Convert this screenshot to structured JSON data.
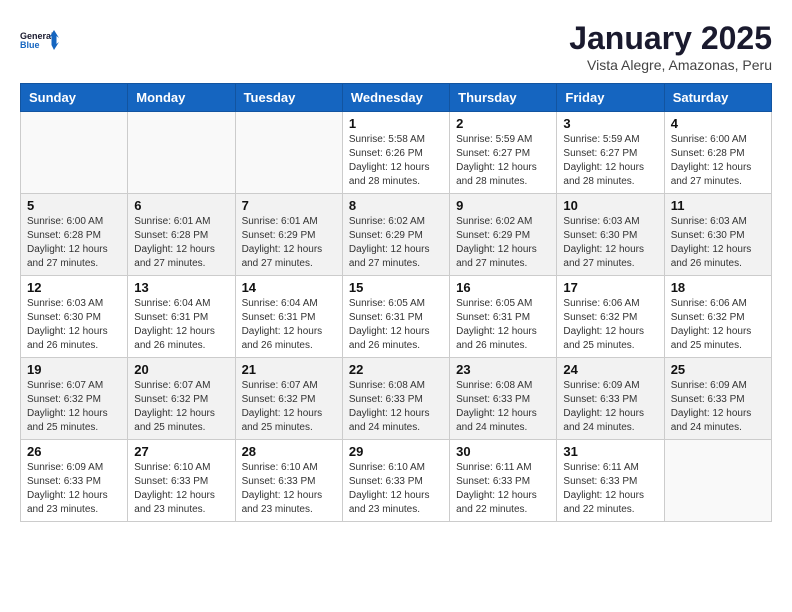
{
  "logo": {
    "line1": "General",
    "line2": "Blue"
  },
  "title": "January 2025",
  "subtitle": "Vista Alegre, Amazonas, Peru",
  "weekdays": [
    "Sunday",
    "Monday",
    "Tuesday",
    "Wednesday",
    "Thursday",
    "Friday",
    "Saturday"
  ],
  "weeks": [
    [
      {
        "day": "",
        "sunrise": "",
        "sunset": "",
        "daylight": ""
      },
      {
        "day": "",
        "sunrise": "",
        "sunset": "",
        "daylight": ""
      },
      {
        "day": "",
        "sunrise": "",
        "sunset": "",
        "daylight": ""
      },
      {
        "day": "1",
        "sunrise": "Sunrise: 5:58 AM",
        "sunset": "Sunset: 6:26 PM",
        "daylight": "Daylight: 12 hours and 28 minutes."
      },
      {
        "day": "2",
        "sunrise": "Sunrise: 5:59 AM",
        "sunset": "Sunset: 6:27 PM",
        "daylight": "Daylight: 12 hours and 28 minutes."
      },
      {
        "day": "3",
        "sunrise": "Sunrise: 5:59 AM",
        "sunset": "Sunset: 6:27 PM",
        "daylight": "Daylight: 12 hours and 28 minutes."
      },
      {
        "day": "4",
        "sunrise": "Sunrise: 6:00 AM",
        "sunset": "Sunset: 6:28 PM",
        "daylight": "Daylight: 12 hours and 27 minutes."
      }
    ],
    [
      {
        "day": "5",
        "sunrise": "Sunrise: 6:00 AM",
        "sunset": "Sunset: 6:28 PM",
        "daylight": "Daylight: 12 hours and 27 minutes."
      },
      {
        "day": "6",
        "sunrise": "Sunrise: 6:01 AM",
        "sunset": "Sunset: 6:28 PM",
        "daylight": "Daylight: 12 hours and 27 minutes."
      },
      {
        "day": "7",
        "sunrise": "Sunrise: 6:01 AM",
        "sunset": "Sunset: 6:29 PM",
        "daylight": "Daylight: 12 hours and 27 minutes."
      },
      {
        "day": "8",
        "sunrise": "Sunrise: 6:02 AM",
        "sunset": "Sunset: 6:29 PM",
        "daylight": "Daylight: 12 hours and 27 minutes."
      },
      {
        "day": "9",
        "sunrise": "Sunrise: 6:02 AM",
        "sunset": "Sunset: 6:29 PM",
        "daylight": "Daylight: 12 hours and 27 minutes."
      },
      {
        "day": "10",
        "sunrise": "Sunrise: 6:03 AM",
        "sunset": "Sunset: 6:30 PM",
        "daylight": "Daylight: 12 hours and 27 minutes."
      },
      {
        "day": "11",
        "sunrise": "Sunrise: 6:03 AM",
        "sunset": "Sunset: 6:30 PM",
        "daylight": "Daylight: 12 hours and 26 minutes."
      }
    ],
    [
      {
        "day": "12",
        "sunrise": "Sunrise: 6:03 AM",
        "sunset": "Sunset: 6:30 PM",
        "daylight": "Daylight: 12 hours and 26 minutes."
      },
      {
        "day": "13",
        "sunrise": "Sunrise: 6:04 AM",
        "sunset": "Sunset: 6:31 PM",
        "daylight": "Daylight: 12 hours and 26 minutes."
      },
      {
        "day": "14",
        "sunrise": "Sunrise: 6:04 AM",
        "sunset": "Sunset: 6:31 PM",
        "daylight": "Daylight: 12 hours and 26 minutes."
      },
      {
        "day": "15",
        "sunrise": "Sunrise: 6:05 AM",
        "sunset": "Sunset: 6:31 PM",
        "daylight": "Daylight: 12 hours and 26 minutes."
      },
      {
        "day": "16",
        "sunrise": "Sunrise: 6:05 AM",
        "sunset": "Sunset: 6:31 PM",
        "daylight": "Daylight: 12 hours and 26 minutes."
      },
      {
        "day": "17",
        "sunrise": "Sunrise: 6:06 AM",
        "sunset": "Sunset: 6:32 PM",
        "daylight": "Daylight: 12 hours and 25 minutes."
      },
      {
        "day": "18",
        "sunrise": "Sunrise: 6:06 AM",
        "sunset": "Sunset: 6:32 PM",
        "daylight": "Daylight: 12 hours and 25 minutes."
      }
    ],
    [
      {
        "day": "19",
        "sunrise": "Sunrise: 6:07 AM",
        "sunset": "Sunset: 6:32 PM",
        "daylight": "Daylight: 12 hours and 25 minutes."
      },
      {
        "day": "20",
        "sunrise": "Sunrise: 6:07 AM",
        "sunset": "Sunset: 6:32 PM",
        "daylight": "Daylight: 12 hours and 25 minutes."
      },
      {
        "day": "21",
        "sunrise": "Sunrise: 6:07 AM",
        "sunset": "Sunset: 6:32 PM",
        "daylight": "Daylight: 12 hours and 25 minutes."
      },
      {
        "day": "22",
        "sunrise": "Sunrise: 6:08 AM",
        "sunset": "Sunset: 6:33 PM",
        "daylight": "Daylight: 12 hours and 24 minutes."
      },
      {
        "day": "23",
        "sunrise": "Sunrise: 6:08 AM",
        "sunset": "Sunset: 6:33 PM",
        "daylight": "Daylight: 12 hours and 24 minutes."
      },
      {
        "day": "24",
        "sunrise": "Sunrise: 6:09 AM",
        "sunset": "Sunset: 6:33 PM",
        "daylight": "Daylight: 12 hours and 24 minutes."
      },
      {
        "day": "25",
        "sunrise": "Sunrise: 6:09 AM",
        "sunset": "Sunset: 6:33 PM",
        "daylight": "Daylight: 12 hours and 24 minutes."
      }
    ],
    [
      {
        "day": "26",
        "sunrise": "Sunrise: 6:09 AM",
        "sunset": "Sunset: 6:33 PM",
        "daylight": "Daylight: 12 hours and 23 minutes."
      },
      {
        "day": "27",
        "sunrise": "Sunrise: 6:10 AM",
        "sunset": "Sunset: 6:33 PM",
        "daylight": "Daylight: 12 hours and 23 minutes."
      },
      {
        "day": "28",
        "sunrise": "Sunrise: 6:10 AM",
        "sunset": "Sunset: 6:33 PM",
        "daylight": "Daylight: 12 hours and 23 minutes."
      },
      {
        "day": "29",
        "sunrise": "Sunrise: 6:10 AM",
        "sunset": "Sunset: 6:33 PM",
        "daylight": "Daylight: 12 hours and 23 minutes."
      },
      {
        "day": "30",
        "sunrise": "Sunrise: 6:11 AM",
        "sunset": "Sunset: 6:33 PM",
        "daylight": "Daylight: 12 hours and 22 minutes."
      },
      {
        "day": "31",
        "sunrise": "Sunrise: 6:11 AM",
        "sunset": "Sunset: 6:33 PM",
        "daylight": "Daylight: 12 hours and 22 minutes."
      },
      {
        "day": "",
        "sunrise": "",
        "sunset": "",
        "daylight": ""
      }
    ]
  ]
}
